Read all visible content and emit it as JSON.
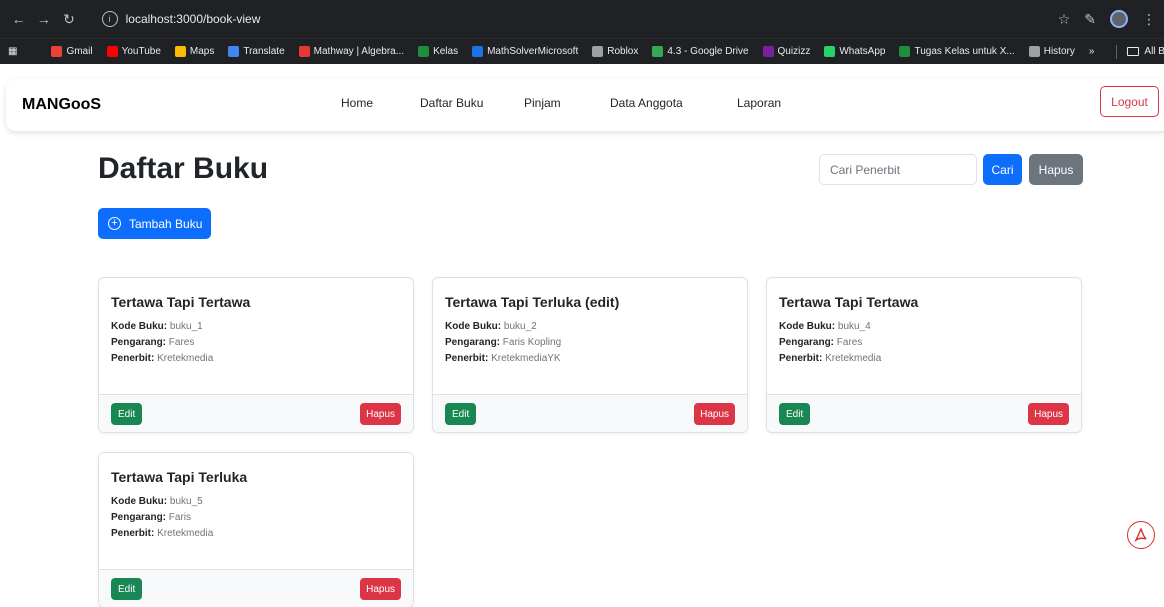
{
  "browser": {
    "url": "localhost:3000/book-view",
    "bookmarks": [
      {
        "label": "Gmail",
        "color": "#ea4335"
      },
      {
        "label": "YouTube",
        "color": "#ff0000"
      },
      {
        "label": "Maps",
        "color": "#fbbc04"
      },
      {
        "label": "Translate",
        "color": "#4285f4"
      },
      {
        "label": "Mathway | Algebra...",
        "color": "#e53935"
      },
      {
        "label": "Kelas",
        "color": "#1e8e3e"
      },
      {
        "label": "MathSolverMicrosoft",
        "color": "#1a73e8"
      },
      {
        "label": "Roblox",
        "color": "#9aa0a6"
      },
      {
        "label": "4.3 - Google Drive",
        "color": "#34a853"
      },
      {
        "label": "Quizizz",
        "color": "#7b1fa2"
      },
      {
        "label": "WhatsApp",
        "color": "#25d366"
      },
      {
        "label": "Tugas Kelas untuk X...",
        "color": "#1e8e3e"
      },
      {
        "label": "History",
        "color": "#9aa0a6"
      }
    ],
    "all_bookmarks": "All Bookmarks",
    "more": "»"
  },
  "nav": {
    "brand": "MANGooS",
    "links": [
      "Home",
      "Daftar Buku",
      "Pinjam",
      "Data Anggota",
      "Laporan"
    ],
    "logout": "Logout"
  },
  "page": {
    "title": "Daftar Buku",
    "search_placeholder": "Cari Penerbit",
    "search_button": "Cari",
    "clear_button": "Hapus",
    "add_button": "Tambah Buku"
  },
  "labels": {
    "kode": "Kode Buku:",
    "pengarang": "Pengarang:",
    "penerbit": "Penerbit:",
    "edit": "Edit",
    "hapus": "Hapus"
  },
  "books": [
    {
      "title": "Tertawa Tapi Tertawa",
      "kode": "buku_1",
      "pengarang": "Fares",
      "penerbit": "Kretekmedia"
    },
    {
      "title": "Tertawa Tapi Terluka (edit)",
      "kode": "buku_2",
      "pengarang": "Faris Kopling",
      "penerbit": "KretekmediaYK"
    },
    {
      "title": "Tertawa Tapi Tertawa",
      "kode": "buku_4",
      "pengarang": "Fares",
      "penerbit": "Kretekmedia"
    },
    {
      "title": "Tertawa Tapi Terluka",
      "kode": "buku_5",
      "pengarang": "Faris",
      "penerbit": "Kretekmedia"
    }
  ]
}
